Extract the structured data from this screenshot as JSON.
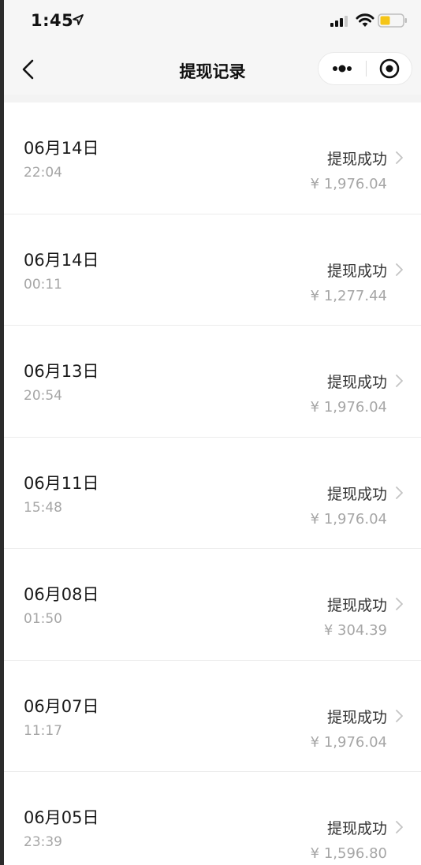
{
  "status_bar": {
    "time": "1:45"
  },
  "nav": {
    "title": "提现记录"
  },
  "records": [
    {
      "date": "06月14日",
      "time": "22:04",
      "status": "提现成功",
      "amount": "¥ 1,976.04"
    },
    {
      "date": "06月14日",
      "time": "00:11",
      "status": "提现成功",
      "amount": "¥ 1,277.44"
    },
    {
      "date": "06月13日",
      "time": "20:54",
      "status": "提现成功",
      "amount": "¥ 1,976.04"
    },
    {
      "date": "06月11日",
      "time": "15:48",
      "status": "提现成功",
      "amount": "¥ 1,976.04"
    },
    {
      "date": "06月08日",
      "time": "01:50",
      "status": "提现成功",
      "amount": "¥ 304.39"
    },
    {
      "date": "06月07日",
      "time": "11:17",
      "status": "提现成功",
      "amount": "¥ 1,976.04"
    },
    {
      "date": "06月05日",
      "time": "23:39",
      "status": "提现成功",
      "amount": "¥ 1,596.80"
    }
  ],
  "colors": {
    "background": "#ffffff",
    "header_background": "#f6f6f6",
    "secondary_text": "#a6a6a6",
    "battery_fill": "#f5c518"
  }
}
